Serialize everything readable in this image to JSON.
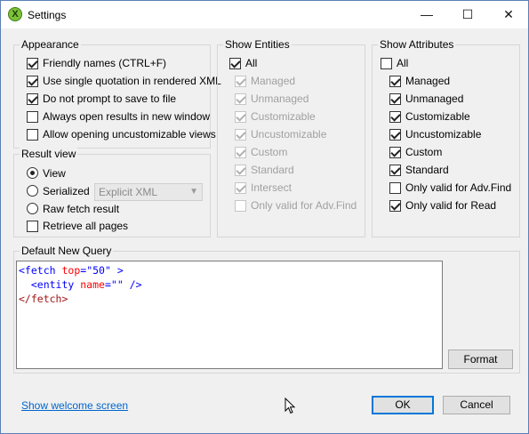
{
  "window": {
    "title": "Settings",
    "app_icon_letter": "X",
    "minimize": "—",
    "maximize": "☐",
    "close": "✕"
  },
  "appearance": {
    "label": "Appearance",
    "items": [
      {
        "label": "Friendly names (CTRL+F)",
        "checked": true
      },
      {
        "label": "Use single quotation in rendered XML",
        "checked": true
      },
      {
        "label": "Do not prompt to save to file",
        "checked": true
      },
      {
        "label": "Always open results in new window",
        "checked": false
      },
      {
        "label": "Allow opening uncustomizable views",
        "checked": false
      }
    ]
  },
  "result_view": {
    "label": "Result view",
    "view": "View",
    "serialized": "Serialized",
    "serialized_option": "Explicit XML",
    "raw": "Raw fetch result",
    "retrieve_all": "Retrieve all pages",
    "selected": "View"
  },
  "show_entities": {
    "label": "Show Entities",
    "all": "All",
    "items": [
      {
        "label": "Managed",
        "checked": true
      },
      {
        "label": "Unmanaged",
        "checked": true
      },
      {
        "label": "Customizable",
        "checked": true
      },
      {
        "label": "Uncustomizable",
        "checked": true
      },
      {
        "label": "Custom",
        "checked": true
      },
      {
        "label": "Standard",
        "checked": true
      },
      {
        "label": "Intersect",
        "checked": true
      },
      {
        "label": "Only valid for Adv.Find",
        "checked": false
      }
    ]
  },
  "show_attributes": {
    "label": "Show Attributes",
    "all": "All",
    "items": [
      {
        "label": "Managed",
        "checked": true
      },
      {
        "label": "Unmanaged",
        "checked": true
      },
      {
        "label": "Customizable",
        "checked": true
      },
      {
        "label": "Uncustomizable",
        "checked": true
      },
      {
        "label": "Custom",
        "checked": true
      },
      {
        "label": "Standard",
        "checked": true
      },
      {
        "label": "Only valid for Adv.Find",
        "checked": false
      },
      {
        "label": "Only valid for Read",
        "checked": true
      }
    ]
  },
  "default_query": {
    "label": "Default New Query",
    "line1": {
      "open": "<fetch ",
      "attr": "top",
      "eq": "=",
      "val": "\"50\"",
      "close": " >"
    },
    "line2": {
      "indent": "  ",
      "open": "<entity ",
      "attr": "name",
      "eq": "=",
      "val": "\"\"",
      "close": " />"
    },
    "line3": "</fetch>",
    "format_button": "Format"
  },
  "footer": {
    "welcome_link": "Show welcome screen",
    "ok": "OK",
    "cancel": "Cancel"
  },
  "colors": {
    "accent": "#0078d7",
    "link": "#0066cc",
    "xml_tag": "#a31515",
    "xml_attr": "#ff0000",
    "xml_value": "#0000ff"
  }
}
